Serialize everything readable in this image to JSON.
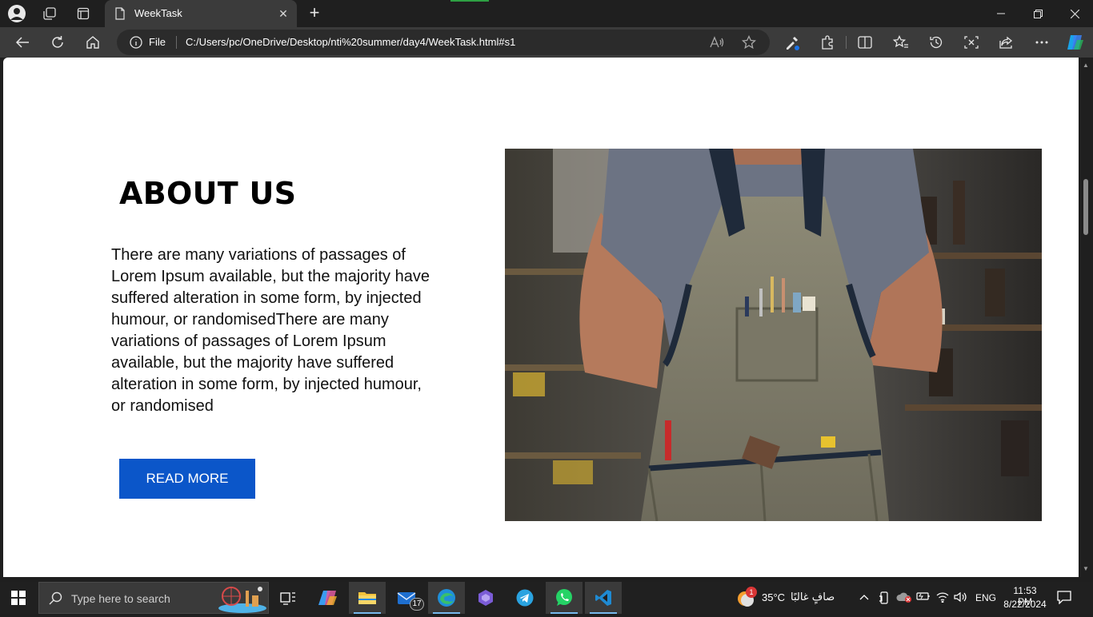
{
  "browser": {
    "tab_title": "WeekTask",
    "url_scheme_label": "File",
    "url": "C:/Users/pc/OneDrive/Desktop/nti%20summer/day4/WeekTask.html#s1",
    "colors": {
      "frame": "#1f1f1f",
      "toolbar": "#3b3b3b",
      "urlbox": "#2b2b2b"
    }
  },
  "page": {
    "heading": "ABOUT US",
    "paragraph": "There are many variations of passages of Lorem Ipsum available, but the majority have suffered alteration in some form, by injected humour, or randomisedThere are many variations of passages of Lorem Ipsum available, but the majority have suffered alteration in some form, by injected humour, or randomised",
    "button_label": "READ MORE",
    "colors": {
      "button": "#0b56c9"
    }
  },
  "taskbar": {
    "search_placeholder": "Type here to search",
    "mail_badge": "17",
    "weather_badge": "1",
    "temperature": "35°C",
    "weather_condition": "صافٍ غالبًا",
    "language": "ENG",
    "time": "11:53 PM",
    "date": "8/22/2024"
  }
}
